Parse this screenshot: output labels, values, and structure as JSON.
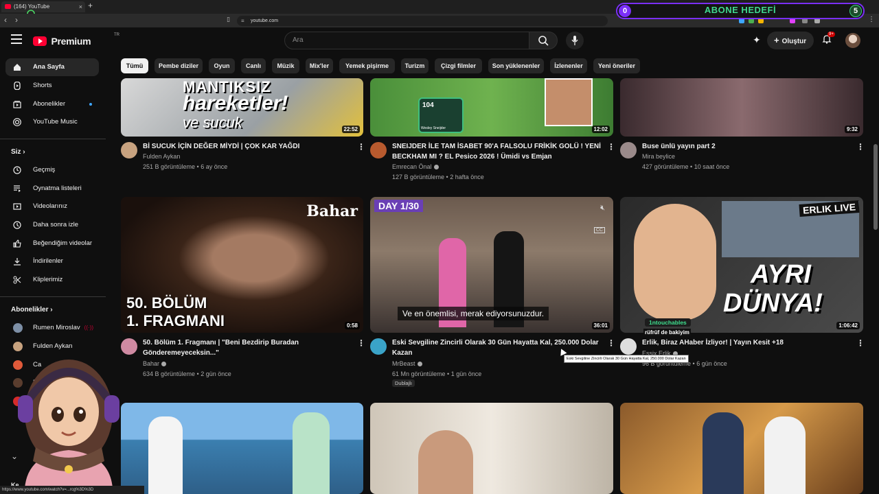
{
  "browser": {
    "tab_title": "(164) YouTube",
    "tab_close": "×",
    "new_tab": "+",
    "url": "youtube.com"
  },
  "overlay": {
    "goal_label": "ABONE HEDEFİ",
    "current": "0",
    "target": "5"
  },
  "masthead": {
    "brand": "Premium",
    "region": "TR",
    "search_placeholder": "Ara",
    "create_label": "Oluştur",
    "notification_count": "9+"
  },
  "sidebar": {
    "main": [
      {
        "label": "Ana Sayfa"
      },
      {
        "label": "Shorts"
      },
      {
        "label": "Abonelikler"
      },
      {
        "label": "YouTube Music"
      }
    ],
    "you_heading": "Siz",
    "you_items": [
      {
        "label": "Geçmiş"
      },
      {
        "label": "Oynatma listeleri"
      },
      {
        "label": "Videolarınız"
      },
      {
        "label": "Daha sonra izle"
      },
      {
        "label": "Beğendiğim videolar"
      },
      {
        "label": "İndirilenler"
      },
      {
        "label": "Kliplerimiz"
      }
    ],
    "subs_heading": "Abonelikler",
    "subs": [
      {
        "label": "Rumen Miroslav"
      },
      {
        "label": "Fulden Aykan"
      },
      {
        "label": "Ca"
      },
      {
        "label": "E"
      }
    ],
    "bottom_text": "Ke"
  },
  "chips": [
    "Tümü",
    "Pembe diziler",
    "Oyun",
    "Canlı",
    "Müzik",
    "Mix'ler",
    "Yemek pişirme",
    "Turizm",
    "Çizgi filmler",
    "Son yüklenenler",
    "İzlenenler",
    "Yeni öneriler"
  ],
  "videos": [
    {
      "title": "Bİ SUCUK İÇİN DEĞER MİYDİ | ÇOK KAR YAĞDI",
      "title2": "",
      "channel": "Fulden Aykan",
      "meta": "251 B görüntüleme • 6 ay önce",
      "duration": "22:52",
      "thumb_text1": "MANTIKSIZ",
      "thumb_text2": "hareketler!",
      "thumb_text3": "ve sucuk"
    },
    {
      "title": "SNEIJDER İLE TAM İSABET 90'A FALSOLU FRİKİK GOLÜ ! YENİ",
      "title2": "BECKHAM MI ? EL Pesico 2026 ! Ümidi vs Emjan",
      "channel": "Emrecan Önal",
      "meta": "127 B görüntüleme • 2 hafta önce",
      "duration": "12:02",
      "thumb_text1": "Wesley Sneijder",
      "thumb_text2": "104"
    },
    {
      "title": "Buse ünlü yayın part 2",
      "title2": "",
      "channel": "Mira beylice",
      "meta": "427 görüntüleme • 10 saat önce",
      "duration": "9:32"
    },
    {
      "title": "50. Bölüm 1. Fragmanı | \"Beni Bezdirip Buradan",
      "title2": "Gönderemeyeceksin...\"",
      "channel": "Bahar",
      "meta": "634 B görüntüleme • 2 gün önce",
      "duration": "0:58",
      "thumb_text1": "50. BÖLÜM",
      "thumb_text2": "1. FRAGMANI",
      "thumb_logo": "Bahar"
    },
    {
      "title": "Eski Sevgiline Zincirli Olarak 30 Gün Hayatta Kal, 250.000 Dolar",
      "title2": "Kazan",
      "channel": "MrBeast",
      "meta": "61 Mn görüntüleme • 1 gün önce",
      "duration": "36:01",
      "badge": "Dublajlı",
      "thumb_text1": "DAY 1/30",
      "caption": "Ve en önemlisi, merak ediyorsunuzdur.",
      "tooltip": "Eski Sevgiline Zincirli Olarak 30 Gün Hayatta Kal, 250.000 Dolar Kazan"
    },
    {
      "title": "Erlik, Biraz AHaber İzliyor! | Yayın Kesit +18",
      "title2": "",
      "channel": "Essix Erlik",
      "meta": "96 B görüntüleme • 6 gün önce",
      "duration": "1:06:42",
      "thumb_text1": "AYRI",
      "thumb_text2": "DÜNYA!",
      "thumb_live": "ERLIK LIVE"
    }
  ],
  "stream_overlay": {
    "touch_label": "1ntouchables",
    "touch_text": "rüfrüf de bakiyim"
  },
  "status_url": "https://www.youtube.com/watch?v=...rcg%3D%3D"
}
